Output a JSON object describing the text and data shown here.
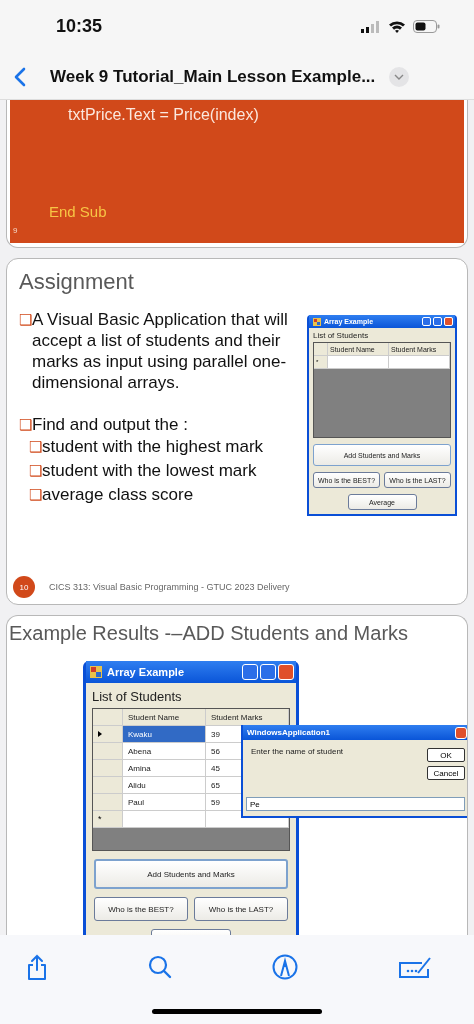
{
  "status_bar": {
    "time": "10:35"
  },
  "nav_bar": {
    "title": "Week 9 Tutorial_Main Lesson Example..."
  },
  "slides": [
    {
      "kind": "code",
      "code_lines": [
        {
          "kind": "statement",
          "text": "txtPrice.Text = Price(index)"
        },
        {
          "kind": "keyword",
          "text": "End Sub"
        }
      ],
      "number": "9"
    },
    {
      "kind": "assignment",
      "title": "Assignment",
      "bullets": [
        {
          "marker": "❑",
          "text": "A Visual Basic Application that will accept a list of students and their marks as input using parallel one-dimensional arrays."
        },
        {
          "marker": "❑",
          "text": "Find and output the :",
          "children": [
            {
              "marker": "❑",
              "text": "student with the highest mark"
            },
            {
              "marker": "❑",
              "text": "student with the lowest mark"
            },
            {
              "marker": "❑",
              "text": " average class score"
            }
          ]
        }
      ],
      "window": {
        "title": "Array Example",
        "label": "List of Students",
        "columns": [
          "Student Name",
          "Student Marks"
        ],
        "new_row_marker": "*",
        "buttons": [
          {
            "kind": "wide",
            "label": "Add Students and Marks"
          },
          {
            "kind": "half",
            "label": "Who is the BEST?"
          },
          {
            "kind": "half",
            "label": "Who is the LAST?"
          },
          {
            "kind": "center",
            "label": "Average"
          }
        ]
      },
      "number": "10",
      "footer": "CICS 313: Visual Basic Programming - GTUC 2023 Delivery"
    },
    {
      "kind": "example",
      "title": "Example Results -–ADD Students and Marks",
      "window": {
        "title": "Array Example",
        "label": "List of Students",
        "columns": [
          "Student Name",
          "Student Marks"
        ],
        "rows": [
          {
            "name": "Kwaku",
            "marks": "39",
            "selected": true
          },
          {
            "name": "Abena",
            "marks": "56",
            "selected": false
          },
          {
            "name": "Amina",
            "marks": "45",
            "selected": false
          },
          {
            "name": "Alidu",
            "marks": "65",
            "selected": false
          },
          {
            "name": "Paul",
            "marks": "59",
            "selected": false
          }
        ],
        "new_row_marker": "*",
        "buttons": [
          {
            "kind": "wide",
            "label": "Add Students and Marks"
          },
          {
            "kind": "half",
            "label": "Who is the BEST?"
          },
          {
            "kind": "half",
            "label": "Who is the LAST?"
          },
          {
            "kind": "cut"
          }
        ]
      },
      "dialog": {
        "title": "WindowsApplication1",
        "prompt": "Enter the name of student",
        "buttons": [
          "OK",
          "Cancel"
        ],
        "value": "Pe"
      }
    }
  ]
}
